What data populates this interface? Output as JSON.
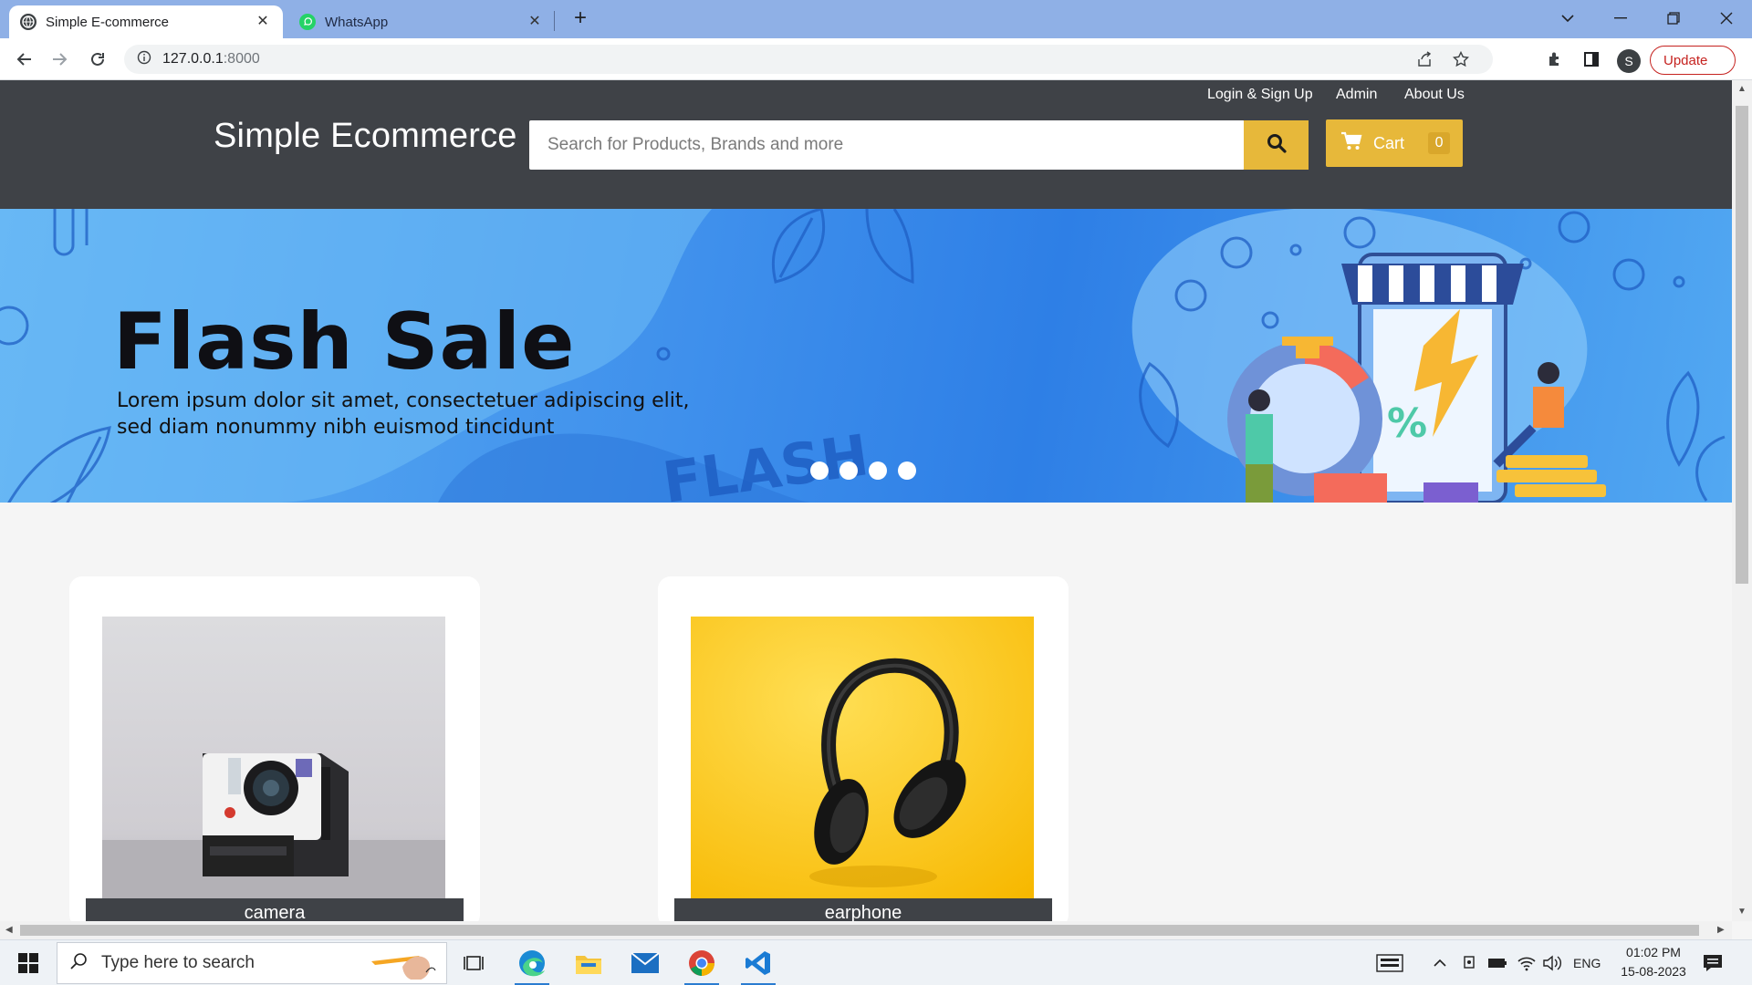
{
  "browser": {
    "tabs": [
      {
        "title": "Simple E-commerce",
        "active": true
      },
      {
        "title": "WhatsApp",
        "active": false
      }
    ],
    "address": {
      "host": "127.0.0.1",
      "port": ":8000"
    },
    "profile_initial": "S",
    "update_label": "Update"
  },
  "site": {
    "nav": {
      "login": "Login & Sign Up",
      "admin": "Admin",
      "about": "About Us"
    },
    "brand": "Simple Ecommerce",
    "search_placeholder": "Search for Products, Brands and more",
    "cart": {
      "label": "Cart",
      "count": "0"
    },
    "banner": {
      "headline": "Flash Sale",
      "text": "Lorem ipsum dolor sit amet, consectetuer adipiscing elit, sed diam nonummy nibh euismod tincidunt",
      "slide_count": 4
    },
    "products": [
      {
        "name": "camera"
      },
      {
        "name": "earphone"
      }
    ]
  },
  "taskbar": {
    "search_placeholder": "Type here to search",
    "language": "ENG",
    "time": "01:02 PM",
    "date": "15-08-2023"
  },
  "colors": {
    "header_bg": "#3f4247",
    "accent": "#e7b83a",
    "tabstrip": "#8fb0e6"
  }
}
